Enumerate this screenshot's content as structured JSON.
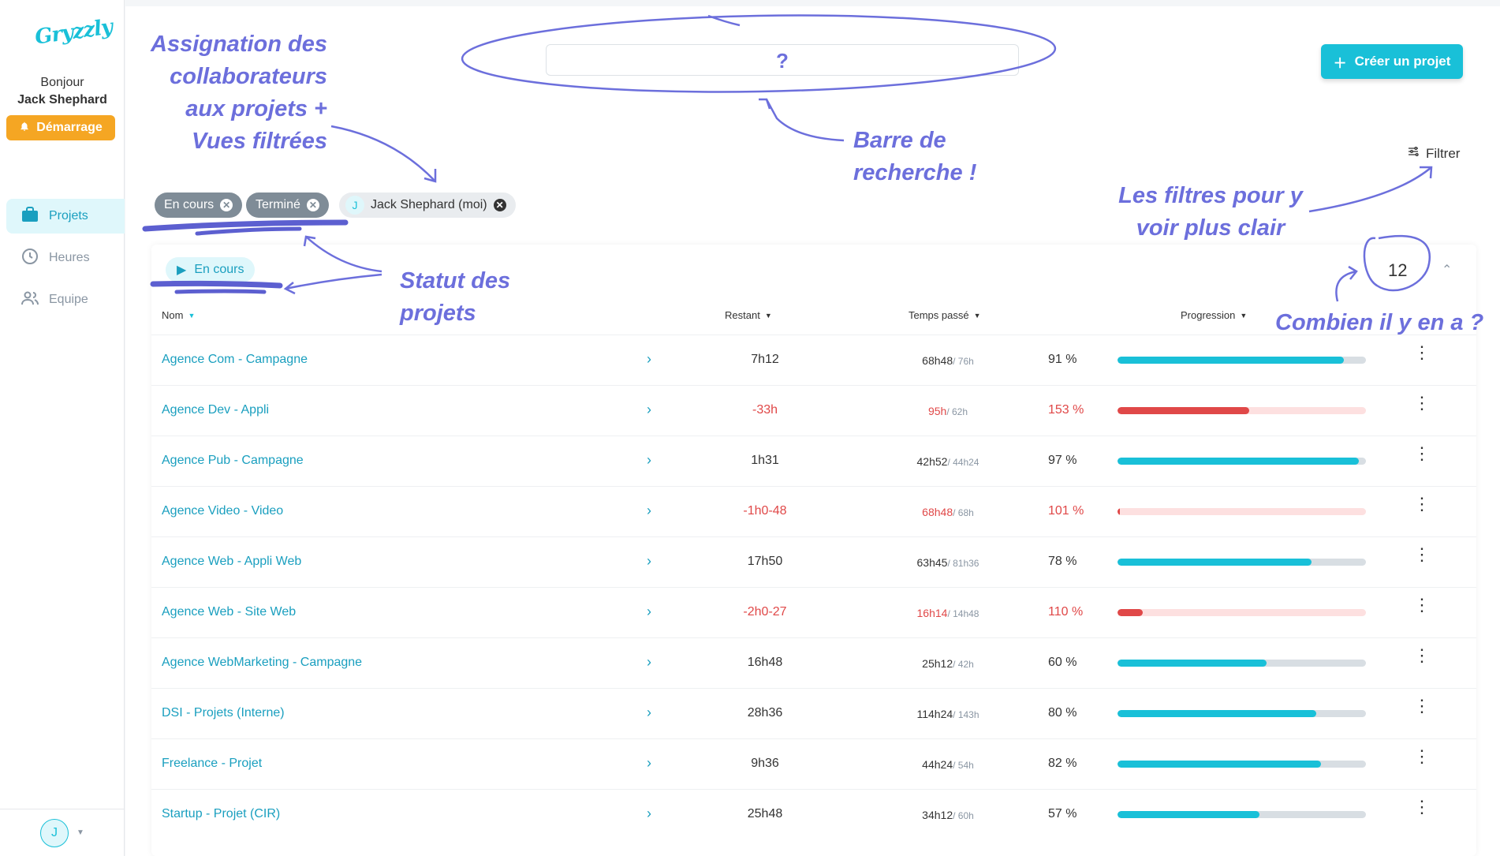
{
  "app": {
    "logo": "Gryzzly",
    "greeting": "Bonjour",
    "user_name": "Jack Shephard",
    "demarrage_label": "Démarrage",
    "avatar_initial": "J"
  },
  "sidebar": {
    "items": [
      {
        "label": "Projets",
        "icon": "briefcase-icon",
        "active": true
      },
      {
        "label": "Heures",
        "icon": "clock-icon",
        "active": false
      },
      {
        "label": "Equipe",
        "icon": "team-icon",
        "active": false
      }
    ]
  },
  "header": {
    "search_value": "?",
    "create_label": "Créer un projet",
    "filter_label": "Filtrer"
  },
  "filters": {
    "chips": [
      {
        "label": "En cours"
      },
      {
        "label": "Terminé"
      },
      {
        "label": "Jack Shephard (moi)",
        "avatar": "J"
      }
    ]
  },
  "group": {
    "status_label": "En cours",
    "count": "12"
  },
  "table": {
    "columns": [
      "Nom",
      "Restant",
      "Temps passé",
      "Progression"
    ],
    "rows": [
      {
        "name": "Agence Com - Campagne",
        "restant": "7h12",
        "passe": "68h48",
        "estime": "/ 76h",
        "pct_label": "91 %",
        "progress": 0.91,
        "over": false
      },
      {
        "name": "Agence Dev - Appli",
        "restant": "-33h",
        "passe": "95h",
        "estime": "/ 62h",
        "pct_label": "153 %",
        "progress": 0.53,
        "over": true
      },
      {
        "name": "Agence Pub - Campagne",
        "restant": "1h31",
        "passe": "42h52",
        "estime": "/ 44h24",
        "pct_label": "97 %",
        "progress": 0.97,
        "over": false
      },
      {
        "name": "Agence Video - Video",
        "restant": "-1h0-48",
        "passe": "68h48",
        "estime": "/ 68h",
        "pct_label": "101 %",
        "progress": 0.01,
        "over": true
      },
      {
        "name": "Agence Web - Appli Web",
        "restant": "17h50",
        "passe": "63h45",
        "estime": "/ 81h36",
        "pct_label": "78 %",
        "progress": 0.78,
        "over": false
      },
      {
        "name": "Agence Web - Site Web",
        "restant": "-2h0-27",
        "passe": "16h14",
        "estime": "/ 14h48",
        "pct_label": "110 %",
        "progress": 0.1,
        "over": true
      },
      {
        "name": "Agence WebMarketing - Campagne",
        "restant": "16h48",
        "passe": "25h12",
        "estime": "/ 42h",
        "pct_label": "60 %",
        "progress": 0.6,
        "over": false
      },
      {
        "name": "DSI - Projets (Interne)",
        "restant": "28h36",
        "passe": "114h24",
        "estime": "/ 143h",
        "pct_label": "80 %",
        "progress": 0.8,
        "over": false
      },
      {
        "name": "Freelance - Projet",
        "restant": "9h36",
        "passe": "44h24",
        "estime": "/ 54h",
        "pct_label": "82 %",
        "progress": 0.82,
        "over": false
      },
      {
        "name": "Startup - Projet (CIR)",
        "restant": "25h48",
        "passe": "34h12",
        "estime": "/ 60h",
        "pct_label": "57 %",
        "progress": 0.57,
        "over": false
      }
    ]
  },
  "annotations": {
    "assignation": [
      "Assignation des",
      "collaborateurs",
      "aux projets +",
      "Vues filtrées"
    ],
    "barre": [
      "Barre de",
      "recherche !"
    ],
    "filtres": [
      "Les filtres pour y",
      "voir plus clair"
    ],
    "statut": [
      "Statut des",
      "projets"
    ],
    "combien": "Combien il y en a ?"
  },
  "colors": {
    "accent": "#19c0d8",
    "warning": "#f5a623",
    "danger": "#e04848",
    "annotation": "#6c6fdc"
  }
}
